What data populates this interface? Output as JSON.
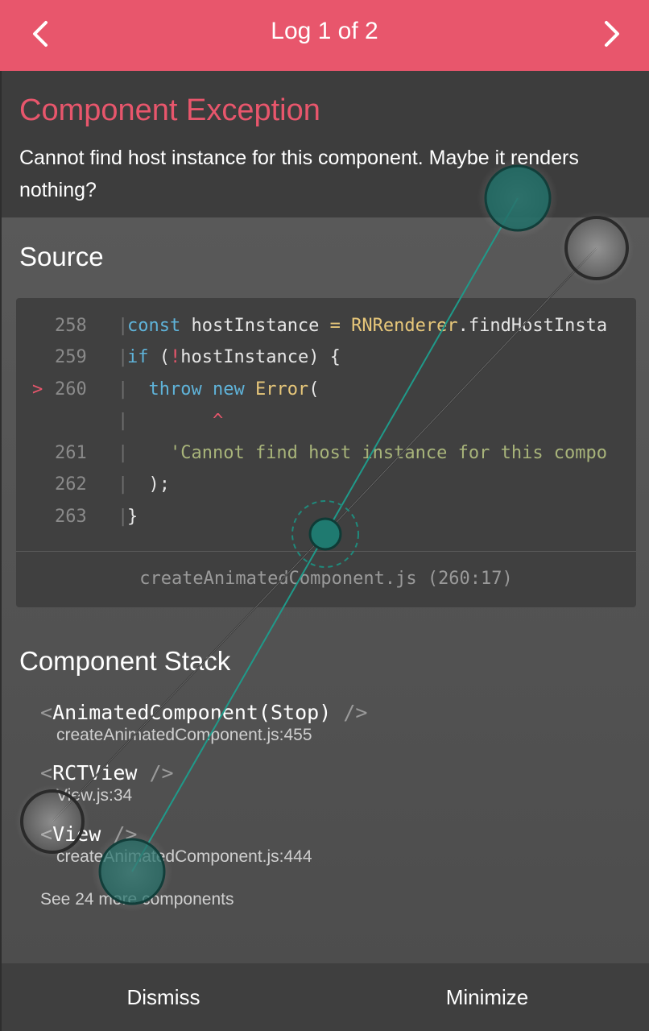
{
  "header": {
    "title": "Log 1 of 2",
    "prev_icon": "chevron-left-icon",
    "next_icon": "chevron-right-icon"
  },
  "exception": {
    "title": "Component Exception",
    "message": "Cannot find host instance for this component. Maybe it renders nothing?"
  },
  "source": {
    "title": "Source",
    "lines": [
      {
        "marker": "",
        "num": "258",
        "tokens": [
          {
            "t": "const ",
            "c": "kw"
          },
          {
            "t": "hostInstance ",
            "c": "id"
          },
          {
            "t": "= ",
            "c": "cls"
          },
          {
            "t": "RNRenderer",
            "c": "cls"
          },
          {
            "t": ".",
            "c": "id"
          },
          {
            "t": "findHostInsta",
            "c": "id"
          }
        ]
      },
      {
        "marker": "",
        "num": "259",
        "tokens": [
          {
            "t": "if ",
            "c": "kw"
          },
          {
            "t": "(",
            "c": "id"
          },
          {
            "t": "!",
            "c": "caret"
          },
          {
            "t": "hostInstance) {",
            "c": "id"
          }
        ]
      },
      {
        "marker": ">",
        "num": "260",
        "tokens": [
          {
            "t": "  throw ",
            "c": "kw"
          },
          {
            "t": "new ",
            "c": "kw"
          },
          {
            "t": "Error",
            "c": "cls"
          },
          {
            "t": "(",
            "c": "id"
          }
        ]
      },
      {
        "marker": "",
        "num": "",
        "tokens": [
          {
            "t": "        ^",
            "c": "caret"
          }
        ]
      },
      {
        "marker": "",
        "num": "261",
        "tokens": [
          {
            "t": "    'Cannot find host instance for this compo",
            "c": "str"
          }
        ]
      },
      {
        "marker": "",
        "num": "262",
        "tokens": [
          {
            "t": "  );",
            "c": "id"
          }
        ]
      },
      {
        "marker": "",
        "num": "263",
        "tokens": [
          {
            "t": "}",
            "c": "id"
          }
        ]
      }
    ],
    "file": "createAnimatedComponent.js (260:17)"
  },
  "stack": {
    "title": "Component Stack",
    "items": [
      {
        "component": "AnimatedComponent(Stop)",
        "location": "createAnimatedComponent.js:455"
      },
      {
        "component": "RCTView",
        "location": "View.js:34"
      },
      {
        "component": "View",
        "location": "createAnimatedComponent.js:444"
      }
    ],
    "see_more": "See 24 more components"
  },
  "footer": {
    "dismiss": "Dismiss",
    "minimize": "Minimize"
  },
  "colors": {
    "accent": "#e8566c",
    "touch_indicator": "#1f7a70"
  }
}
